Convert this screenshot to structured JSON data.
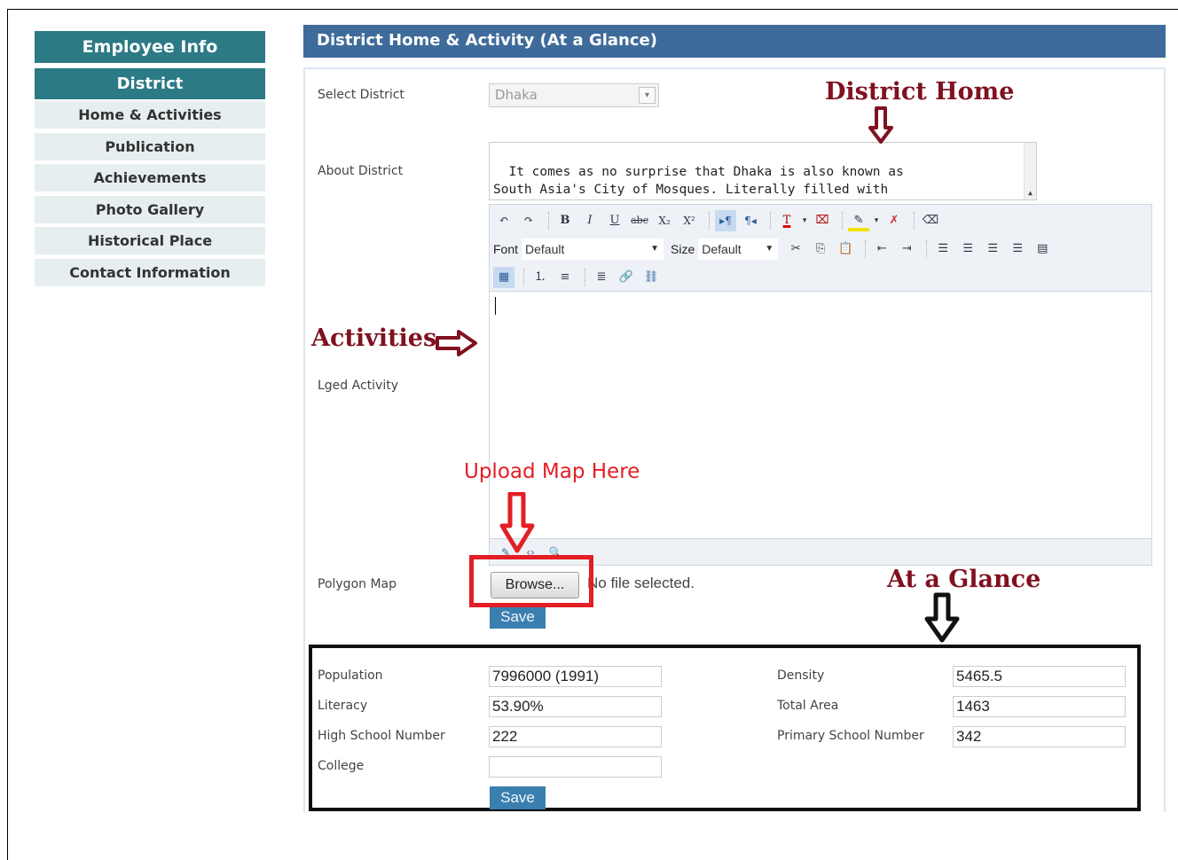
{
  "sidebar": {
    "heading": "Employee Info",
    "section": "District",
    "items": [
      {
        "label": "Home & Activities"
      },
      {
        "label": "Publication"
      },
      {
        "label": "Achievements"
      },
      {
        "label": "Photo Gallery"
      },
      {
        "label": "Historical Place"
      },
      {
        "label": "Contact Information"
      }
    ]
  },
  "main": {
    "title": "District Home & Activity (At a Glance)",
    "select_district_label": "Select District",
    "select_district_value": "Dhaka",
    "about_label": "About District",
    "about_text": "It comes as no surprise that Dhaka is also known as\nSouth Asia's City of Mosques. Literally filled with\nmosques which are both idyllic and ancient, Dhaka",
    "lged_label": "Lged Activity",
    "polygon_label": "Polygon Map",
    "browse_label": "Browse...",
    "file_status": "No file selected.",
    "save_label": "Save"
  },
  "editor": {
    "font_label": "Font",
    "font_value": "Default",
    "size_label": "Size",
    "size_value": "Default",
    "bold": "B",
    "italic": "I",
    "underline": "U",
    "subscript": "X₂",
    "superscript": "X²"
  },
  "glance": {
    "population_label": "Population",
    "population_value": "7996000 (1991)",
    "literacy_label": "Literacy",
    "literacy_value": "53.90%",
    "high_school_label": "High School Number",
    "high_school_value": "222",
    "college_label": "College",
    "college_value": "",
    "density_label": "Density",
    "density_value": "5465.5",
    "total_area_label": "Total Area",
    "total_area_value": "1463",
    "primary_school_label": "Primary School Number",
    "primary_school_value": "342",
    "save_label": "Save"
  },
  "annotations": {
    "district_home": "District Home",
    "activities": "Activities",
    "upload_map": "Upload Map Here",
    "at_a_glance": "At a Glance"
  },
  "colors": {
    "sidebar_heading": "#2b7a85",
    "header_bar": "#3e6b9a",
    "annotation_dark_red": "#7f1120",
    "annotation_red": "#e31e24"
  }
}
